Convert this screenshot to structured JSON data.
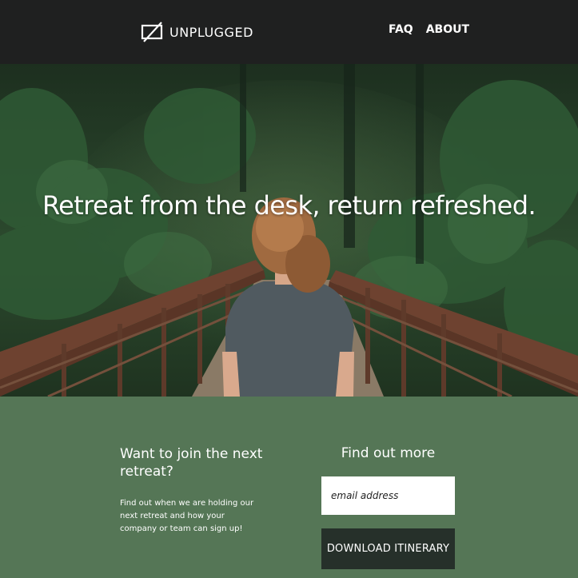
{
  "header": {
    "brand": "UNPLUGGED",
    "brand_icon": "crossed-out-rectangle-icon",
    "nav": [
      {
        "label": "FAQ"
      },
      {
        "label": "ABOUT"
      }
    ]
  },
  "hero": {
    "title": "Retreat from the desk, return refreshed."
  },
  "signup": {
    "join_heading": "Want to join the next retreat?",
    "join_text": "Find out when we are holding our next retreat and how your company or team can sign up!",
    "more_heading": "Find out more",
    "email_placeholder": "email address",
    "download_label": "DOWNLOAD ITINERARY"
  },
  "colors": {
    "header_bg": "#1f2020",
    "section_bg": "#557656",
    "button_bg": "#26302a"
  }
}
